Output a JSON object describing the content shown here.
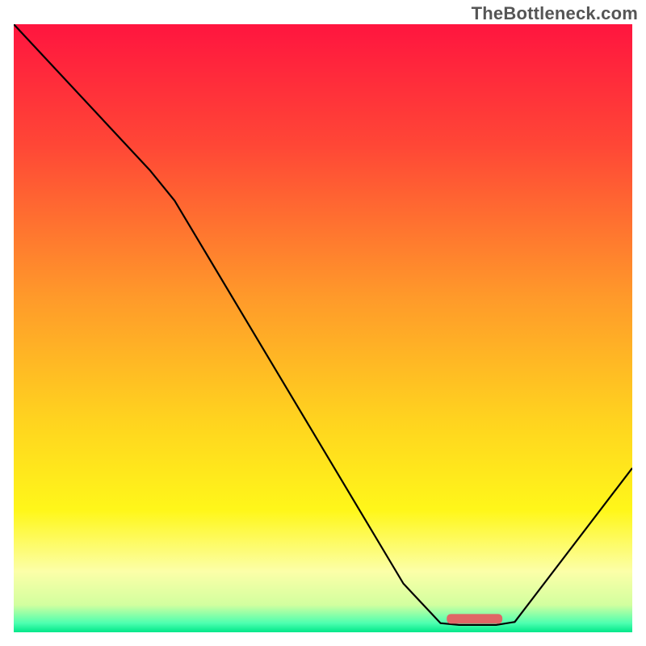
{
  "chart_data": {
    "type": "line",
    "title": "",
    "xlabel": "",
    "ylabel": "",
    "xlim": [
      0,
      100
    ],
    "ylim": [
      0,
      100
    ],
    "watermark": "TheBottleneck.com",
    "curve": [
      {
        "x": 0,
        "y": 100
      },
      {
        "x": 22,
        "y": 76
      },
      {
        "x": 26,
        "y": 71
      },
      {
        "x": 63,
        "y": 8
      },
      {
        "x": 69,
        "y": 1.5
      },
      {
        "x": 72,
        "y": 1.2
      },
      {
        "x": 78,
        "y": 1.2
      },
      {
        "x": 81,
        "y": 1.7
      },
      {
        "x": 100,
        "y": 27
      }
    ],
    "marker": {
      "x_start": 70,
      "x_end": 79,
      "y": 2.2
    },
    "gradient_stops": [
      {
        "offset": 0,
        "color": "#ff153f"
      },
      {
        "offset": 0.2,
        "color": "#ff4736"
      },
      {
        "offset": 0.45,
        "color": "#ff9a2a"
      },
      {
        "offset": 0.65,
        "color": "#ffd31f"
      },
      {
        "offset": 0.8,
        "color": "#fff71a"
      },
      {
        "offset": 0.9,
        "color": "#fcffa8"
      },
      {
        "offset": 0.955,
        "color": "#d2ff9f"
      },
      {
        "offset": 0.985,
        "color": "#4dffb0"
      },
      {
        "offset": 1.0,
        "color": "#00e789"
      }
    ],
    "colors": {
      "curve_stroke": "#000000",
      "marker_fill": "#e06666",
      "background": "#ffffff"
    }
  }
}
